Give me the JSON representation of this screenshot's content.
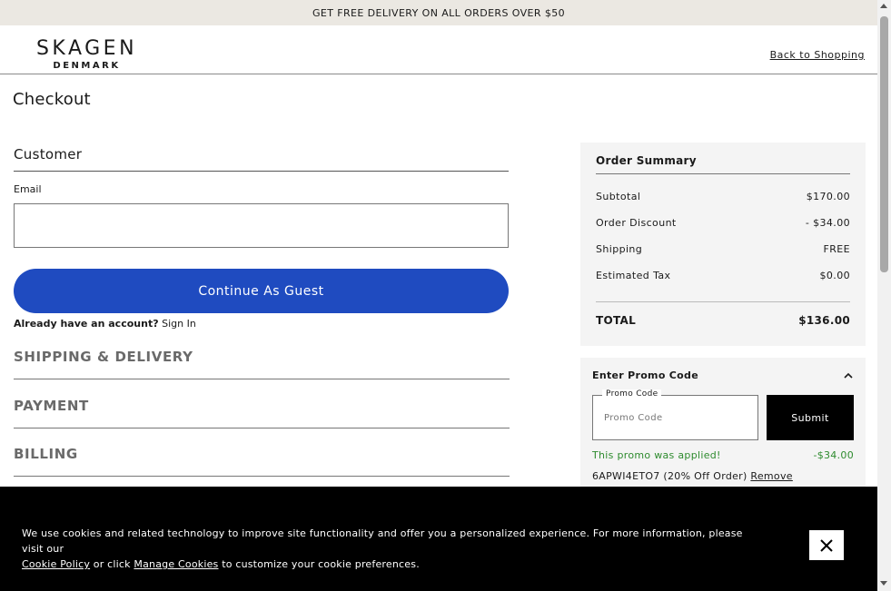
{
  "banner": {
    "text": "GET FREE DELIVERY ON ALL ORDERS OVER $50"
  },
  "header": {
    "logo_brand": "SKAGEN",
    "logo_sub": "DENMARK",
    "back_link": "Back to Shopping"
  },
  "page": {
    "title": "Checkout"
  },
  "customer": {
    "heading": "Customer",
    "email_label": "Email",
    "email_value": "",
    "continue_button": "Continue As Guest",
    "account_question": "Already have an account?",
    "sign_in": "Sign In"
  },
  "sections": {
    "shipping": "SHIPPING & DELIVERY",
    "payment": "PAYMENT",
    "billing": "BILLING"
  },
  "summary": {
    "title": "Order Summary",
    "rows": [
      {
        "label": "Subtotal",
        "value": "$170.00"
      },
      {
        "label": "Order Discount",
        "value": "- $34.00"
      },
      {
        "label": "Shipping",
        "value": "FREE"
      },
      {
        "label": "Estimated Tax",
        "value": "$0.00"
      }
    ],
    "total_label": "TOTAL",
    "total_value": "$136.00"
  },
  "promo": {
    "heading": "Enter Promo Code",
    "field_label": "Promo Code",
    "placeholder": "Promo Code",
    "submit": "Submit",
    "applied_message": "This promo was applied!",
    "applied_amount": "-$34.00",
    "code_text": "6APWI4ETO7 (20% Off Order)",
    "remove": "Remove"
  },
  "cookie": {
    "text_before": "We use cookies and related technology to improve site functionality and offer you a personalized experience. For more information, please visit our",
    "policy_link": "Cookie Policy",
    "text_middle": "or click",
    "manage_link": "Manage Cookies",
    "text_after": "to customize your cookie preferences."
  },
  "colors": {
    "accent": "#1f4bc0",
    "banner_bg": "#ebe8e2",
    "success": "#2e8b2e"
  },
  "icons": {
    "promo_toggle": "chevron-up-icon",
    "cookie_close": "close-icon"
  }
}
